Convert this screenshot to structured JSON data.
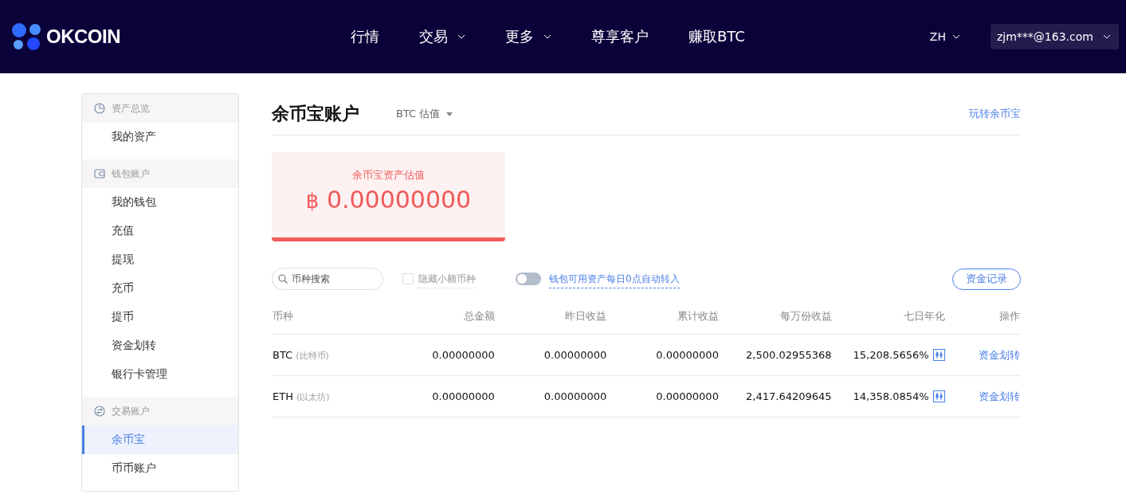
{
  "header": {
    "logo": "OKCOIN",
    "nav": [
      {
        "label": "行情",
        "has_menu": false
      },
      {
        "label": "交易",
        "has_menu": true
      },
      {
        "label": "更多",
        "has_menu": true
      },
      {
        "label": "尊享客户",
        "has_menu": false
      },
      {
        "label": "赚取BTC",
        "has_menu": false
      }
    ],
    "language": "ZH",
    "account": "zjm***@163.com"
  },
  "sidebar": {
    "groups": [
      {
        "title": "资产总览",
        "items": [
          {
            "label": "我的资产",
            "selected": false
          }
        ]
      },
      {
        "title": "钱包账户",
        "items": [
          {
            "label": "我的钱包",
            "selected": false
          },
          {
            "label": "充值",
            "selected": false
          },
          {
            "label": "提现",
            "selected": false
          },
          {
            "label": "充币",
            "selected": false
          },
          {
            "label": "提币",
            "selected": false
          },
          {
            "label": "资金划转",
            "selected": false
          },
          {
            "label": "银行卡管理",
            "selected": false
          }
        ]
      },
      {
        "title": "交易账户",
        "items": [
          {
            "label": "余币宝",
            "selected": true
          },
          {
            "label": "币币账户",
            "selected": false
          }
        ]
      }
    ]
  },
  "main": {
    "title": "余币宝账户",
    "valuation": "BTC 估值",
    "help_link": "玩转余币宝",
    "summary": {
      "label": "余币宝资产估值",
      "symbol": "฿",
      "amount": "0.00000000"
    },
    "toolbar": {
      "search_placeholder": "币种搜索",
      "hide_small": {
        "label": "隐藏小额币种",
        "checked": false
      },
      "auto_transfer": {
        "label": "钱包可用资产每日0点自动转入",
        "on": false
      },
      "records_button": "资金记录"
    },
    "table": {
      "columns": [
        "币种",
        "总金额",
        "昨日收益",
        "累计收益",
        "每万份收益",
        "七日年化",
        "操作"
      ],
      "rows": [
        {
          "symbol": "BTC",
          "name": "(比特币)",
          "total": "0.00000000",
          "yesterday": "0.00000000",
          "cumulative": "0.00000000",
          "per_10k": "2,500.02955368",
          "seven_day": "15,208.5656%",
          "action": "资金划转"
        },
        {
          "symbol": "ETH",
          "name": "(以太坊)",
          "total": "0.00000000",
          "yesterday": "0.00000000",
          "cumulative": "0.00000000",
          "per_10k": "2,417.64209645",
          "seven_day": "14,358.0854%",
          "action": "资金划转"
        }
      ]
    }
  }
}
